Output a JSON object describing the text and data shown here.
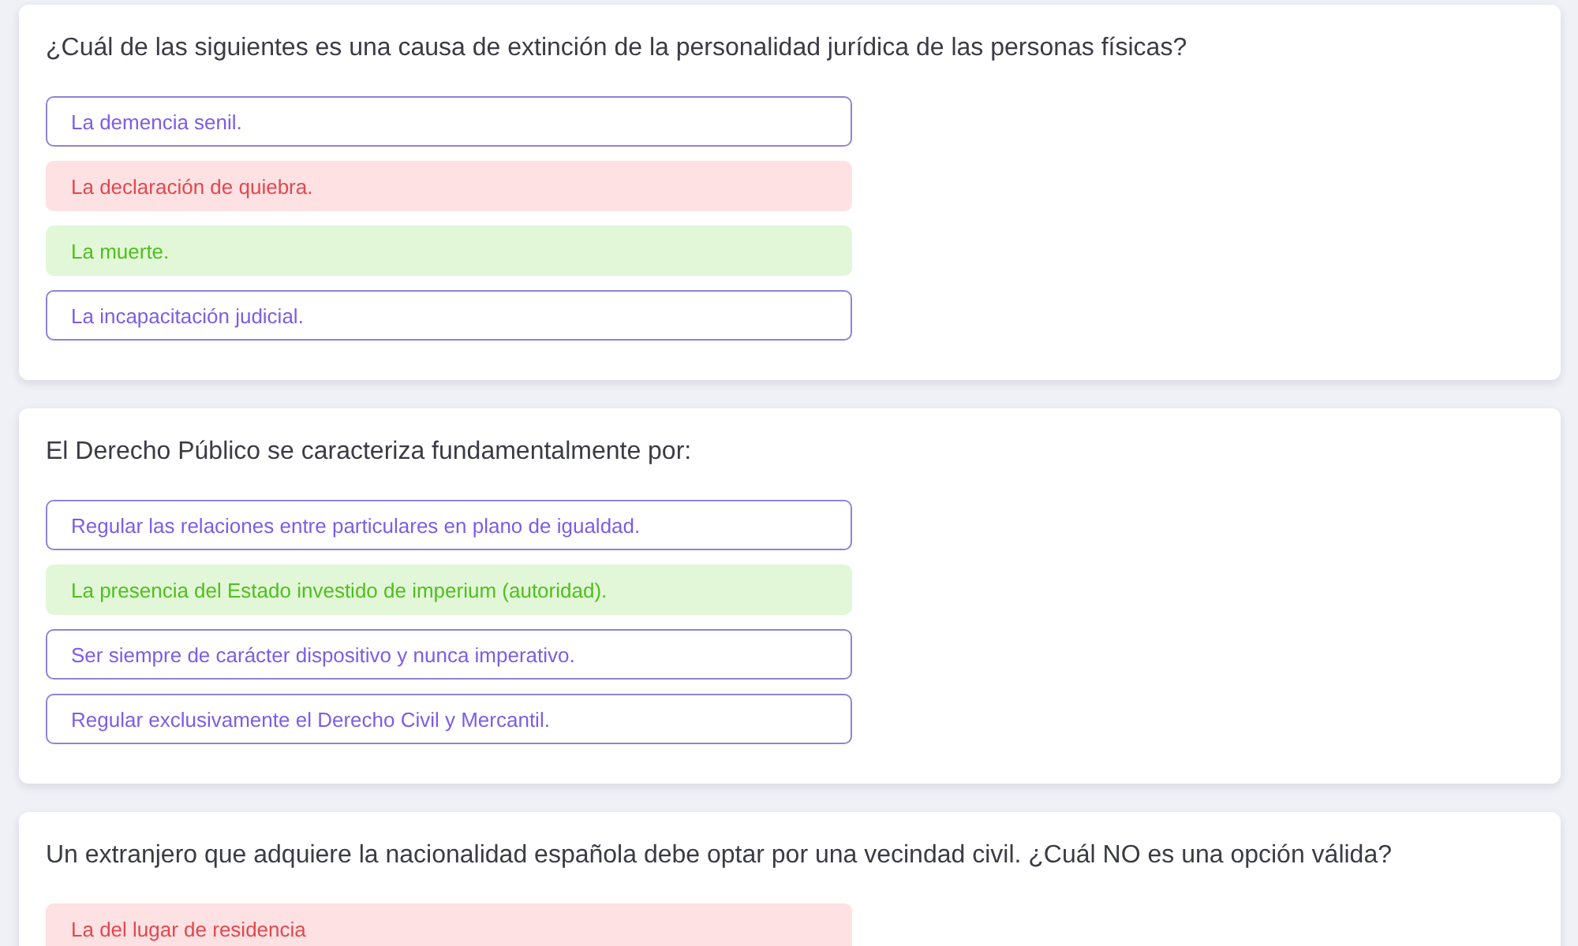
{
  "questions": [
    {
      "question": "¿Cuál de las siguientes es una causa de extinción de la personalidad jurídica de las personas físicas?",
      "options": [
        {
          "text": "La demencia senil.",
          "kind": "plain"
        },
        {
          "text": "La declaración de quiebra.",
          "kind": "wrong"
        },
        {
          "text": "La muerte.",
          "kind": "correct"
        },
        {
          "text": "La incapacitación judicial.",
          "kind": "plain"
        }
      ]
    },
    {
      "question": "El Derecho Público se caracteriza fundamentalmente por:",
      "options": [
        {
          "text": "Regular las relaciones entre particulares en plano de igualdad.",
          "kind": "plain"
        },
        {
          "text": "La presencia del Estado investido de imperium (autoridad).",
          "kind": "correct"
        },
        {
          "text": "Ser siempre de carácter dispositivo y nunca imperativo.",
          "kind": "plain"
        },
        {
          "text": "Regular exclusivamente el Derecho Civil y Mercantil.",
          "kind": "plain"
        }
      ]
    },
    {
      "question": "Un extranjero que adquiere la nacionalidad española debe optar por una vecindad civil. ¿Cuál NO es una opción válida?",
      "options": [
        {
          "text": "La del lugar de residencia",
          "kind": "wrong"
        }
      ]
    }
  ]
}
